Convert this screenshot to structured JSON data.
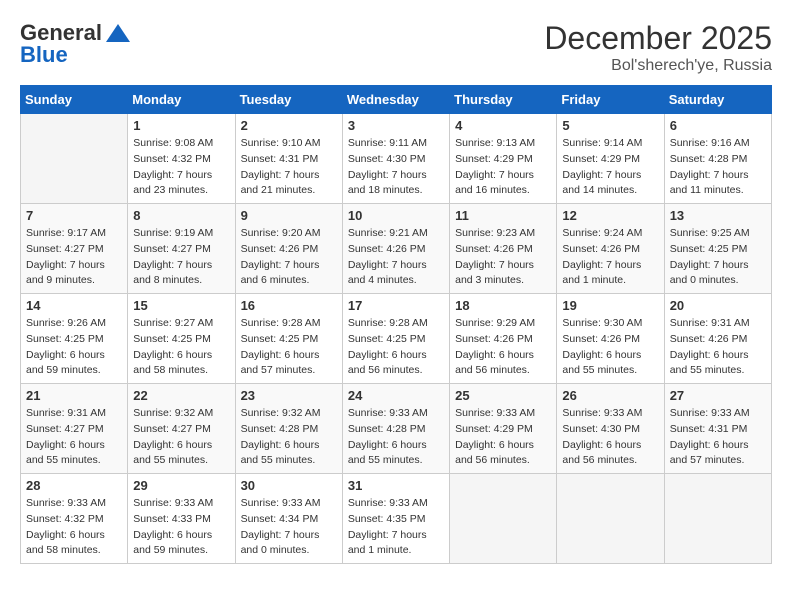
{
  "header": {
    "logo_general": "General",
    "logo_blue": "Blue",
    "month": "December 2025",
    "location": "Bol'sherech'ye, Russia"
  },
  "weekdays": [
    "Sunday",
    "Monday",
    "Tuesday",
    "Wednesday",
    "Thursday",
    "Friday",
    "Saturday"
  ],
  "weeks": [
    [
      {
        "day": "",
        "empty": true
      },
      {
        "day": "1",
        "sunrise": "Sunrise: 9:08 AM",
        "sunset": "Sunset: 4:32 PM",
        "daylight": "Daylight: 7 hours and 23 minutes."
      },
      {
        "day": "2",
        "sunrise": "Sunrise: 9:10 AM",
        "sunset": "Sunset: 4:31 PM",
        "daylight": "Daylight: 7 hours and 21 minutes."
      },
      {
        "day": "3",
        "sunrise": "Sunrise: 9:11 AM",
        "sunset": "Sunset: 4:30 PM",
        "daylight": "Daylight: 7 hours and 18 minutes."
      },
      {
        "day": "4",
        "sunrise": "Sunrise: 9:13 AM",
        "sunset": "Sunset: 4:29 PM",
        "daylight": "Daylight: 7 hours and 16 minutes."
      },
      {
        "day": "5",
        "sunrise": "Sunrise: 9:14 AM",
        "sunset": "Sunset: 4:29 PM",
        "daylight": "Daylight: 7 hours and 14 minutes."
      },
      {
        "day": "6",
        "sunrise": "Sunrise: 9:16 AM",
        "sunset": "Sunset: 4:28 PM",
        "daylight": "Daylight: 7 hours and 11 minutes."
      }
    ],
    [
      {
        "day": "7",
        "sunrise": "Sunrise: 9:17 AM",
        "sunset": "Sunset: 4:27 PM",
        "daylight": "Daylight: 7 hours and 9 minutes."
      },
      {
        "day": "8",
        "sunrise": "Sunrise: 9:19 AM",
        "sunset": "Sunset: 4:27 PM",
        "daylight": "Daylight: 7 hours and 8 minutes."
      },
      {
        "day": "9",
        "sunrise": "Sunrise: 9:20 AM",
        "sunset": "Sunset: 4:26 PM",
        "daylight": "Daylight: 7 hours and 6 minutes."
      },
      {
        "day": "10",
        "sunrise": "Sunrise: 9:21 AM",
        "sunset": "Sunset: 4:26 PM",
        "daylight": "Daylight: 7 hours and 4 minutes."
      },
      {
        "day": "11",
        "sunrise": "Sunrise: 9:23 AM",
        "sunset": "Sunset: 4:26 PM",
        "daylight": "Daylight: 7 hours and 3 minutes."
      },
      {
        "day": "12",
        "sunrise": "Sunrise: 9:24 AM",
        "sunset": "Sunset: 4:26 PM",
        "daylight": "Daylight: 7 hours and 1 minute."
      },
      {
        "day": "13",
        "sunrise": "Sunrise: 9:25 AM",
        "sunset": "Sunset: 4:25 PM",
        "daylight": "Daylight: 7 hours and 0 minutes."
      }
    ],
    [
      {
        "day": "14",
        "sunrise": "Sunrise: 9:26 AM",
        "sunset": "Sunset: 4:25 PM",
        "daylight": "Daylight: 6 hours and 59 minutes."
      },
      {
        "day": "15",
        "sunrise": "Sunrise: 9:27 AM",
        "sunset": "Sunset: 4:25 PM",
        "daylight": "Daylight: 6 hours and 58 minutes."
      },
      {
        "day": "16",
        "sunrise": "Sunrise: 9:28 AM",
        "sunset": "Sunset: 4:25 PM",
        "daylight": "Daylight: 6 hours and 57 minutes."
      },
      {
        "day": "17",
        "sunrise": "Sunrise: 9:28 AM",
        "sunset": "Sunset: 4:25 PM",
        "daylight": "Daylight: 6 hours and 56 minutes."
      },
      {
        "day": "18",
        "sunrise": "Sunrise: 9:29 AM",
        "sunset": "Sunset: 4:26 PM",
        "daylight": "Daylight: 6 hours and 56 minutes."
      },
      {
        "day": "19",
        "sunrise": "Sunrise: 9:30 AM",
        "sunset": "Sunset: 4:26 PM",
        "daylight": "Daylight: 6 hours and 55 minutes."
      },
      {
        "day": "20",
        "sunrise": "Sunrise: 9:31 AM",
        "sunset": "Sunset: 4:26 PM",
        "daylight": "Daylight: 6 hours and 55 minutes."
      }
    ],
    [
      {
        "day": "21",
        "sunrise": "Sunrise: 9:31 AM",
        "sunset": "Sunset: 4:27 PM",
        "daylight": "Daylight: 6 hours and 55 minutes."
      },
      {
        "day": "22",
        "sunrise": "Sunrise: 9:32 AM",
        "sunset": "Sunset: 4:27 PM",
        "daylight": "Daylight: 6 hours and 55 minutes."
      },
      {
        "day": "23",
        "sunrise": "Sunrise: 9:32 AM",
        "sunset": "Sunset: 4:28 PM",
        "daylight": "Daylight: 6 hours and 55 minutes."
      },
      {
        "day": "24",
        "sunrise": "Sunrise: 9:33 AM",
        "sunset": "Sunset: 4:28 PM",
        "daylight": "Daylight: 6 hours and 55 minutes."
      },
      {
        "day": "25",
        "sunrise": "Sunrise: 9:33 AM",
        "sunset": "Sunset: 4:29 PM",
        "daylight": "Daylight: 6 hours and 56 minutes."
      },
      {
        "day": "26",
        "sunrise": "Sunrise: 9:33 AM",
        "sunset": "Sunset: 4:30 PM",
        "daylight": "Daylight: 6 hours and 56 minutes."
      },
      {
        "day": "27",
        "sunrise": "Sunrise: 9:33 AM",
        "sunset": "Sunset: 4:31 PM",
        "daylight": "Daylight: 6 hours and 57 minutes."
      }
    ],
    [
      {
        "day": "28",
        "sunrise": "Sunrise: 9:33 AM",
        "sunset": "Sunset: 4:32 PM",
        "daylight": "Daylight: 6 hours and 58 minutes."
      },
      {
        "day": "29",
        "sunrise": "Sunrise: 9:33 AM",
        "sunset": "Sunset: 4:33 PM",
        "daylight": "Daylight: 6 hours and 59 minutes."
      },
      {
        "day": "30",
        "sunrise": "Sunrise: 9:33 AM",
        "sunset": "Sunset: 4:34 PM",
        "daylight": "Daylight: 7 hours and 0 minutes."
      },
      {
        "day": "31",
        "sunrise": "Sunrise: 9:33 AM",
        "sunset": "Sunset: 4:35 PM",
        "daylight": "Daylight: 7 hours and 1 minute."
      },
      {
        "day": "",
        "empty": true
      },
      {
        "day": "",
        "empty": true
      },
      {
        "day": "",
        "empty": true
      }
    ]
  ]
}
